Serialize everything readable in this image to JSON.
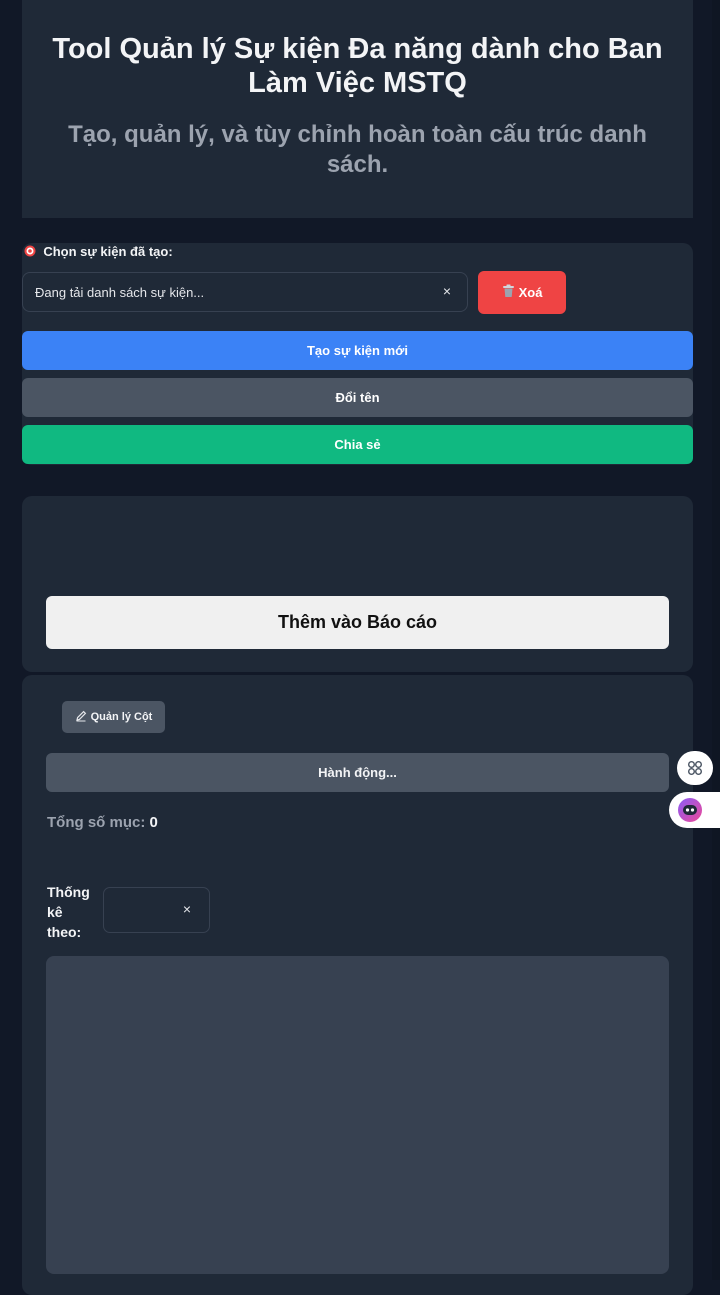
{
  "header": {
    "title": "Tool Quản lý Sự kiện Đa năng dành cho Ban Làm Việc MSTQ",
    "subtitle": "Tạo, quản lý, và tùy chỉnh hoàn toàn cấu trúc danh sách."
  },
  "event_selector": {
    "label": "Chọn sự kiện đã tạo:",
    "value": "Đang tải danh sách sự kiện...",
    "clear": "×",
    "delete_label": "Xoá"
  },
  "actions": {
    "create": "Tạo sự kiện mới",
    "rename": "Đổi tên",
    "share": "Chia sẻ"
  },
  "report": {
    "add_label": "Thêm vào Báo cáo"
  },
  "list": {
    "manage_columns": "Quản lý Cột",
    "actions_label": "Hành động...",
    "total_label": "Tổng số mục:",
    "total_value": "0",
    "stat_by_label": "Thống kê theo:",
    "stat_clear": "×"
  },
  "icons": {
    "target": "target-icon",
    "trash": "trash-icon",
    "pencil": "pencil-icon",
    "grid": "grid-icon",
    "assistant": "assistant-icon"
  },
  "colors": {
    "background": "#111827",
    "panel": "#1f2937",
    "danger": "#ef4444",
    "primary": "#3b82f6",
    "neutral": "#4b5563",
    "success": "#10b981"
  }
}
